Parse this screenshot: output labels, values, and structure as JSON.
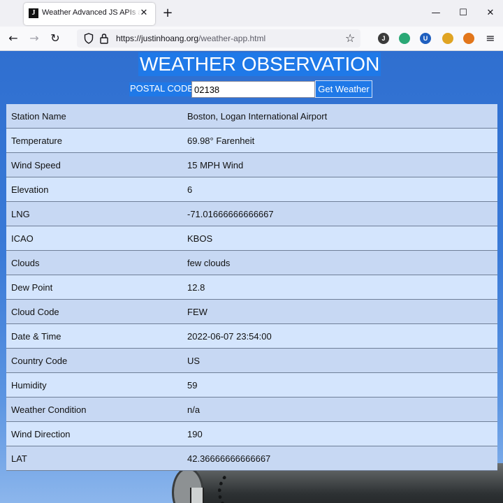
{
  "browser": {
    "tab_title": "Weather Advanced JS APIs and",
    "tab_favicon": "J",
    "url_host": "https://justinhoang.org",
    "url_path": "/weather-app.html",
    "extensions": [
      {
        "name": "j-extension-icon",
        "letter": "J",
        "color": "#3b3b3b"
      },
      {
        "name": "green-extension-icon",
        "letter": "",
        "color": "#2aa876"
      },
      {
        "name": "shield-extension-icon",
        "letter": "U",
        "color": "#1f5fbf"
      },
      {
        "name": "bird-extension-icon",
        "letter": "",
        "color": "#e0a423"
      },
      {
        "name": "fox-extension-icon",
        "letter": "",
        "color": "#e2761b"
      }
    ]
  },
  "page": {
    "title": "WEATHER OBSERVATION",
    "postal_label": "POSTAL CODE:",
    "postal_value": "02138",
    "button_label": "Get Weather"
  },
  "observations": [
    {
      "label": "Station Name",
      "value": "Boston, Logan International Airport"
    },
    {
      "label": "Temperature",
      "value": "69.98° Farenheit"
    },
    {
      "label": "Wind Speed",
      "value": "15 MPH Wind"
    },
    {
      "label": "Elevation",
      "value": "6"
    },
    {
      "label": "LNG",
      "value": "-71.01666666666667"
    },
    {
      "label": "ICAO",
      "value": "KBOS"
    },
    {
      "label": "Clouds",
      "value": "few clouds"
    },
    {
      "label": "Dew Point",
      "value": "12.8"
    },
    {
      "label": "Cloud Code",
      "value": "FEW"
    },
    {
      "label": "Date & Time",
      "value": "2022-06-07 23:54:00"
    },
    {
      "label": "Country Code",
      "value": "US"
    },
    {
      "label": "Humidity",
      "value": "59"
    },
    {
      "label": "Weather Condition",
      "value": "n/a"
    },
    {
      "label": "Wind Direction",
      "value": "190"
    },
    {
      "label": "LAT",
      "value": "42.36666666666667"
    }
  ]
}
